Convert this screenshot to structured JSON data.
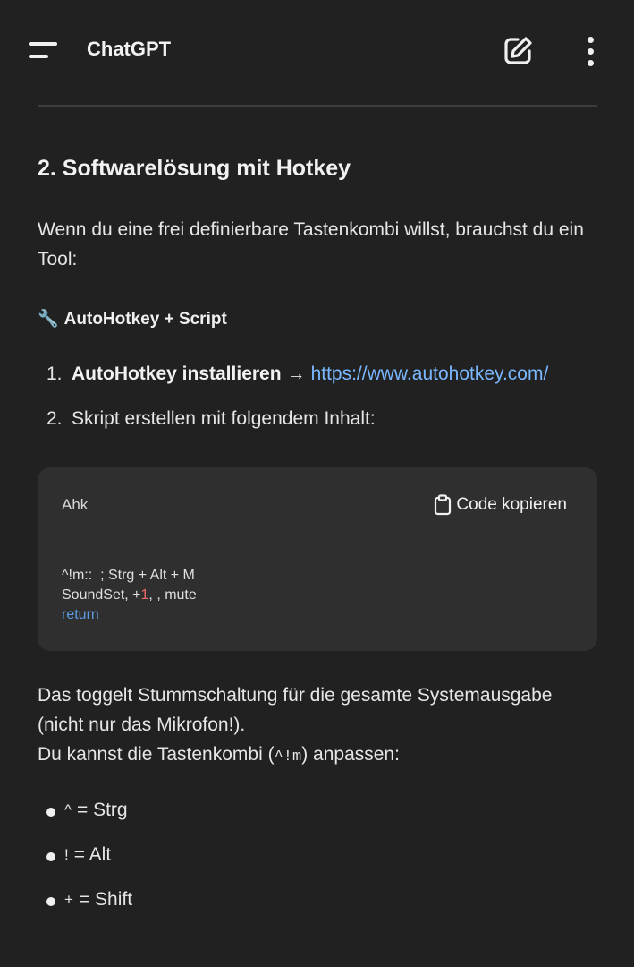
{
  "header": {
    "title": "ChatGPT"
  },
  "content": {
    "heading": "2. Softwarelösung mit Hotkey",
    "intro": "Wenn du eine frei definierbare Tastenkombi willst, brauchst du ein Tool:",
    "tool_line": "AutoHotkey + Script",
    "steps": [
      {
        "num": "1.",
        "bold": "AutoHotkey installieren",
        "arrow": "→",
        "link": "https://www.autohotkey.com/"
      },
      {
        "num": "2.",
        "text": "Skript erstellen mit folgendem Inhalt:"
      }
    ],
    "code_block": {
      "language": "Ahk",
      "copy_label": "Code kopieren",
      "line1": "^!m::  ; Strg + Alt + M",
      "line2_a": "SoundSet, +",
      "line2_num": "1",
      "line2_b": ", , mute",
      "line3": "return"
    },
    "explanation_1": "Das toggelt Stummschaltung für die gesamte Systemausgabe (nicht nur das Mikrofon!).",
    "explanation_2_a": "Du kannst die Tastenkombi (",
    "explanation_2_code": "^!m",
    "explanation_2_b": ") anpassen:",
    "bullets": [
      {
        "sym": "^",
        "text": "= Strg"
      },
      {
        "sym": "!",
        "text": "= Alt"
      },
      {
        "sym": "+",
        "text": "= Shift"
      }
    ]
  }
}
